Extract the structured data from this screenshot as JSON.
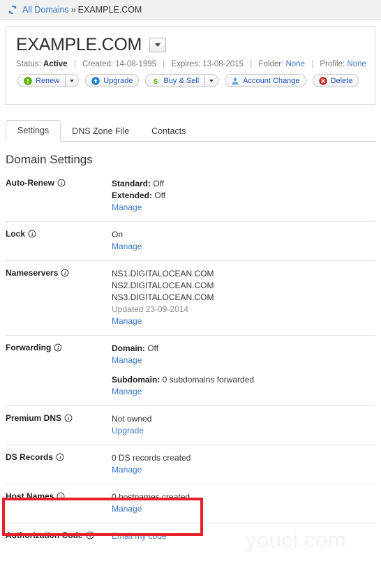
{
  "breadcrumb": {
    "refresh_icon": "refresh-icon",
    "root_label": "All Domains",
    "separator": "»",
    "current_label": "EXAMPLE.COM"
  },
  "header": {
    "domain": "EXAMPLE.COM",
    "dropdown_icon": "chevron-down-icon",
    "meta": {
      "status_label": "Status:",
      "status_value": "Active",
      "created_label": "Created:",
      "created_value": "14-08-1995",
      "expires_label": "Expires:",
      "expires_value": "13-08-2015",
      "folder_label": "Folder:",
      "folder_value": "None",
      "profile_label": "Profile:",
      "profile_value": "None",
      "pipe": "|"
    },
    "actions": [
      {
        "label": "Renew",
        "icon": "green-exclamation-circle-icon",
        "has_caret": true
      },
      {
        "label": "Upgrade",
        "icon": "blue-up-arrow-circle-icon",
        "has_caret": false
      },
      {
        "label": "Buy & Sell",
        "icon": "green-dollar-icon",
        "has_caret": true
      },
      {
        "label": "Account Change",
        "icon": "user-icon",
        "has_caret": false
      },
      {
        "label": "Delete",
        "icon": "red-x-circle-icon",
        "has_caret": false
      }
    ]
  },
  "tabs": [
    {
      "label": "Settings",
      "active": true
    },
    {
      "label": "DNS Zone File",
      "active": false
    },
    {
      "label": "Contacts",
      "active": false
    }
  ],
  "settings": {
    "title": "Domain Settings",
    "rows": {
      "auto_renew": {
        "label": "Auto-Renew",
        "standard_label": "Standard:",
        "standard_value": "Off",
        "extended_label": "Extended:",
        "extended_value": "Off",
        "manage": "Manage"
      },
      "lock": {
        "label": "Lock",
        "value": "On",
        "manage": "Manage"
      },
      "nameservers": {
        "label": "Nameservers",
        "servers": [
          "NS1.DIGITALOCEAN.COM",
          "NS2.DIGITALOCEAN.COM",
          "NS3.DIGITALOCEAN.COM"
        ],
        "updated": "Updated 23-09-2014",
        "manage": "Manage"
      },
      "forwarding": {
        "label": "Forwarding",
        "domain_label": "Domain:",
        "domain_value": "Off",
        "domain_manage": "Manage",
        "subdomain_label": "Subdomain:",
        "subdomain_value": "0 subdomains forwarded",
        "subdomain_manage": "Manage"
      },
      "premium_dns": {
        "label": "Premium DNS",
        "value": "Not owned",
        "upgrade": "Upgrade"
      },
      "ds_records": {
        "label": "DS Records",
        "value": "0 DS records created",
        "manage": "Manage"
      },
      "host_names": {
        "label": "Host Names",
        "value": "0 hostnames created",
        "manage": "Manage"
      },
      "authorization_code": {
        "label": "Authorization Code",
        "action": "Email my code"
      }
    },
    "info_icon": "info-circle-icon"
  },
  "annotation": {
    "highlight_color": "#e8202a",
    "target": "host-names-row"
  },
  "watermark": {
    "text": "youci.com"
  },
  "colors": {
    "link": "#3a78c8",
    "button_text": "#2255bb",
    "page_bg": "#ffffff",
    "bar_bg": "#f1f1f1"
  }
}
